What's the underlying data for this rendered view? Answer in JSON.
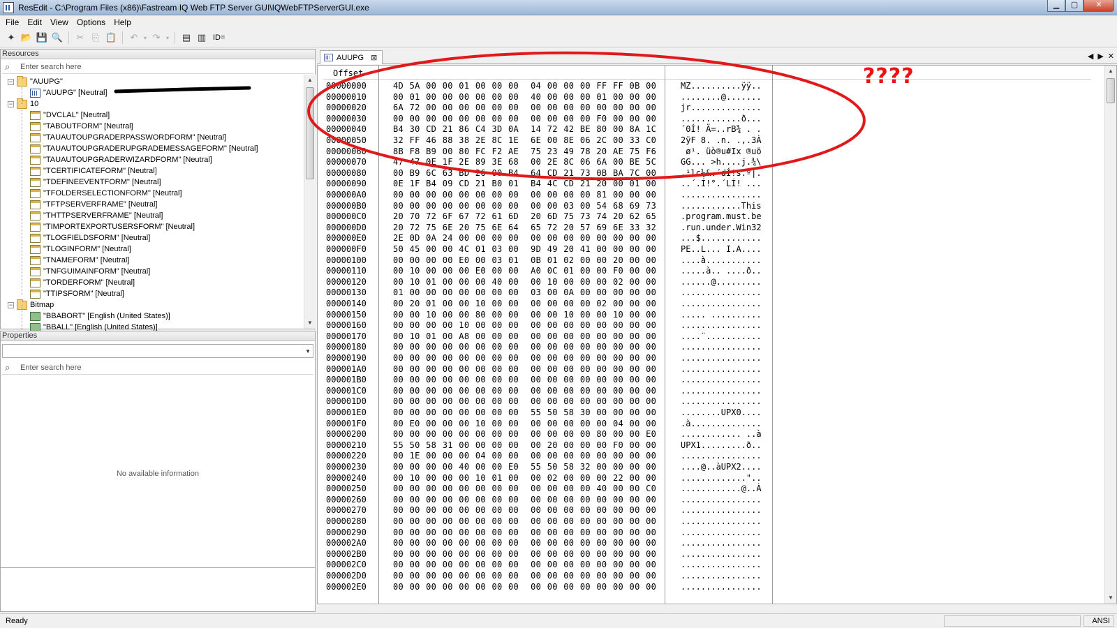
{
  "window": {
    "title": "ResEdit - C:\\Program Files (x86)\\Fastream IQ Web FTP Server GUI\\IQWebFTPServerGUI.exe",
    "buttons": [
      "minimize",
      "maximize",
      "close"
    ]
  },
  "menu": [
    "File",
    "Edit",
    "View",
    "Options",
    "Help"
  ],
  "toolbar": {
    "icons": [
      "new-icon",
      "open-icon",
      "save-icon",
      "print-preview-icon",
      "cut-icon",
      "copy-icon",
      "paste-icon",
      "undo-icon",
      "redo-icon",
      "properties-icon",
      "resource-icon"
    ],
    "id_label": "ID="
  },
  "resources": {
    "header": "Resources",
    "search_placeholder": "Enter search here",
    "tree": [
      {
        "label": "\"AUUPG\"",
        "level": 0,
        "kind": "folder",
        "expander": "−"
      },
      {
        "label": "\"AUUPG\" [Neutral]",
        "level": 1,
        "kind": "bin"
      },
      {
        "label": "10",
        "level": 0,
        "kind": "folder",
        "expander": "−"
      },
      {
        "label": "\"DVCLAL\" [Neutral]",
        "level": 1,
        "kind": "form"
      },
      {
        "label": "\"TABOUTFORM\" [Neutral]",
        "level": 1,
        "kind": "form"
      },
      {
        "label": "\"TAUAUTOUPGRADERPASSWORDFORM\" [Neutral]",
        "level": 1,
        "kind": "form"
      },
      {
        "label": "\"TAUAUTOUPGRADERUPGRADEMESSAGEFORM\" [Neutral]",
        "level": 1,
        "kind": "form"
      },
      {
        "label": "\"TAUAUTOUPGRADERWIZARDFORM\" [Neutral]",
        "level": 1,
        "kind": "form"
      },
      {
        "label": "\"TCERTIFICATEFORM\" [Neutral]",
        "level": 1,
        "kind": "form"
      },
      {
        "label": "\"TDEFINEEVENTFORM\" [Neutral]",
        "level": 1,
        "kind": "form"
      },
      {
        "label": "\"TFOLDERSELECTIONFORM\" [Neutral]",
        "level": 1,
        "kind": "form"
      },
      {
        "label": "\"TFTPSERVERFRAME\" [Neutral]",
        "level": 1,
        "kind": "form"
      },
      {
        "label": "\"THTTPSERVERFRAME\" [Neutral]",
        "level": 1,
        "kind": "form"
      },
      {
        "label": "\"TIMPORTEXPORTUSERSFORM\" [Neutral]",
        "level": 1,
        "kind": "form"
      },
      {
        "label": "\"TLOGFIELDSFORM\" [Neutral]",
        "level": 1,
        "kind": "form"
      },
      {
        "label": "\"TLOGINFORM\" [Neutral]",
        "level": 1,
        "kind": "form"
      },
      {
        "label": "\"TNAMEFORM\" [Neutral]",
        "level": 1,
        "kind": "form"
      },
      {
        "label": "\"TNFGUIMAINFORM\" [Neutral]",
        "level": 1,
        "kind": "form"
      },
      {
        "label": "\"TORDERFORM\" [Neutral]",
        "level": 1,
        "kind": "form"
      },
      {
        "label": "\"TTIPSFORM\" [Neutral]",
        "level": 1,
        "kind": "form"
      },
      {
        "label": "Bitmap",
        "level": 0,
        "kind": "folder",
        "expander": "−"
      },
      {
        "label": "\"BBABORT\" [English (United States)]",
        "level": 1,
        "kind": "bmp"
      },
      {
        "label": "\"BBALL\" [English (United States)]",
        "level": 1,
        "kind": "bmp"
      }
    ]
  },
  "properties": {
    "header": "Properties",
    "search_placeholder": "Enter search here",
    "empty_text": "No available information"
  },
  "editor": {
    "tab_label": "AUUPG",
    "offset_header": "Offset",
    "rows": [
      {
        "off": "00000000",
        "hex": "4D 5A 00 00 01 00 00 00  04 00 00 00 FF FF 0B 00",
        "asc": "MZ..........ÿÿ.."
      },
      {
        "off": "00000010",
        "hex": "00 01 00 00 00 00 00 00  40 00 00 00 01 00 00 00",
        "asc": "........@......."
      },
      {
        "off": "00000020",
        "hex": "6A 72 00 00 00 00 00 00  00 00 00 00 00 00 00 00",
        "asc": "jr.............."
      },
      {
        "off": "00000030",
        "hex": "00 00 00 00 00 00 00 00  00 00 00 00 F0 00 00 00",
        "asc": "............ð..."
      },
      {
        "off": "00000040",
        "hex": "B4 30 CD 21 86 C4 3D 0A  14 72 42 BE 80 00 8A 1C",
        "asc": "´0Í! Ä=..rB¾ . ."
      },
      {
        "off": "00000050",
        "hex": "32 FF 46 88 38 2E 8C 1E  6E 00 8E 06 2C 00 33 C0",
        "asc": "2ÿF 8. .n. .,.3À"
      },
      {
        "off": "00000060",
        "hex": "8B F8 B9 00 80 FC F2 AE  75 23 49 78 20 AE 75 F6",
        "asc": " ø¹. üò®u#Ix ®uö"
      },
      {
        "off": "00000070",
        "hex": "47 47 0E 1F 2E 89 3E 68  00 2E 8C 06 6A 00 BE 5C",
        "asc": "GG... >h....j.¾\\"
      },
      {
        "off": "00000080",
        "hex": "00 B9 6C 63 BD 26 00 B4  64 CD 21 73 0B BA 7C 00",
        "asc": ".¹lc½&.´dÍ!s.º|."
      },
      {
        "off": "00000090",
        "hex": "0E 1F B4 09 CD 21 B0 01  B4 4C CD 21 20 00 01 00",
        "asc": "..´.Í!°.´LÍ! ..."
      },
      {
        "off": "000000A0",
        "hex": "00 00 00 00 00 00 00 00  00 00 00 00 81 00 00 00",
        "asc": "................"
      },
      {
        "off": "000000B0",
        "hex": "00 00 00 00 00 00 00 00  00 00 03 00 54 68 69 73",
        "asc": "............This"
      },
      {
        "off": "000000C0",
        "hex": "20 70 72 6F 67 72 61 6D  20 6D 75 73 74 20 62 65",
        "asc": ".program.must.be"
      },
      {
        "off": "000000D0",
        "hex": "20 72 75 6E 20 75 6E 64  65 72 20 57 69 6E 33 32",
        "asc": ".run.under.Win32"
      },
      {
        "off": "000000E0",
        "hex": "2E 0D 0A 24 00 00 00 00  00 00 00 00 00 00 00 00",
        "asc": "...$............"
      },
      {
        "off": "000000F0",
        "hex": "50 45 00 00 4C 01 03 00  9D 49 20 41 00 00 00 00",
        "asc": "PE..L... I.A...."
      },
      {
        "off": "00000100",
        "hex": "00 00 00 00 E0 00 03 01  0B 01 02 00 00 20 00 00",
        "asc": "....à..........."
      },
      {
        "off": "00000110",
        "hex": "00 10 00 00 00 E0 00 00  A0 0C 01 00 00 F0 00 00",
        "asc": ".....à.. ....ð.."
      },
      {
        "off": "00000120",
        "hex": "00 10 01 00 00 00 40 00  00 10 00 00 00 02 00 00",
        "asc": "......@........."
      },
      {
        "off": "00000130",
        "hex": "01 00 00 00 00 00 00 00  03 00 0A 00 00 00 00 00",
        "asc": "................"
      },
      {
        "off": "00000140",
        "hex": "00 20 01 00 00 10 00 00  00 00 00 00 02 00 00 00",
        "asc": "................"
      },
      {
        "off": "00000150",
        "hex": "00 00 10 00 00 80 00 00  00 00 10 00 00 10 00 00",
        "asc": "..... .........."
      },
      {
        "off": "00000160",
        "hex": "00 00 00 00 10 00 00 00  00 00 00 00 00 00 00 00",
        "asc": "................"
      },
      {
        "off": "00000170",
        "hex": "00 10 01 00 A8 00 00 00  00 00 00 00 00 00 00 00",
        "asc": "....¨..........."
      },
      {
        "off": "00000180",
        "hex": "00 00 00 00 00 00 00 00  00 00 00 00 00 00 00 00",
        "asc": "................"
      },
      {
        "off": "00000190",
        "hex": "00 00 00 00 00 00 00 00  00 00 00 00 00 00 00 00",
        "asc": "................"
      },
      {
        "off": "000001A0",
        "hex": "00 00 00 00 00 00 00 00  00 00 00 00 00 00 00 00",
        "asc": "................"
      },
      {
        "off": "000001B0",
        "hex": "00 00 00 00 00 00 00 00  00 00 00 00 00 00 00 00",
        "asc": "................"
      },
      {
        "off": "000001C0",
        "hex": "00 00 00 00 00 00 00 00  00 00 00 00 00 00 00 00",
        "asc": "................"
      },
      {
        "off": "000001D0",
        "hex": "00 00 00 00 00 00 00 00  00 00 00 00 00 00 00 00",
        "asc": "................"
      },
      {
        "off": "000001E0",
        "hex": "00 00 00 00 00 00 00 00  55 50 58 30 00 00 00 00",
        "asc": "........UPX0...."
      },
      {
        "off": "000001F0",
        "hex": "00 E0 00 00 00 10 00 00  00 00 00 00 00 04 00 00",
        "asc": ".à.............."
      },
      {
        "off": "00000200",
        "hex": "00 00 00 00 00 00 00 00  00 00 00 00 80 00 00 E0",
        "asc": "............ ..à"
      },
      {
        "off": "00000210",
        "hex": "55 50 58 31 00 00 00 00  00 20 00 00 00 F0 00 00",
        "asc": "UPX1.........ð.."
      },
      {
        "off": "00000220",
        "hex": "00 1E 00 00 00 04 00 00  00 00 00 00 00 00 00 00",
        "asc": "................"
      },
      {
        "off": "00000230",
        "hex": "00 00 00 00 40 00 00 E0  55 50 58 32 00 00 00 00",
        "asc": "....@..àUPX2...."
      },
      {
        "off": "00000240",
        "hex": "00 10 00 00 00 10 01 00  00 02 00 00 00 22 00 00",
        "asc": ".............\".."
      },
      {
        "off": "00000250",
        "hex": "00 00 00 00 00 00 00 00  00 00 00 00 40 00 00 C0",
        "asc": "............@..À"
      },
      {
        "off": "00000260",
        "hex": "00 00 00 00 00 00 00 00  00 00 00 00 00 00 00 00",
        "asc": "................"
      },
      {
        "off": "00000270",
        "hex": "00 00 00 00 00 00 00 00  00 00 00 00 00 00 00 00",
        "asc": "................"
      },
      {
        "off": "00000280",
        "hex": "00 00 00 00 00 00 00 00  00 00 00 00 00 00 00 00",
        "asc": "................"
      },
      {
        "off": "00000290",
        "hex": "00 00 00 00 00 00 00 00  00 00 00 00 00 00 00 00",
        "asc": "................"
      },
      {
        "off": "000002A0",
        "hex": "00 00 00 00 00 00 00 00  00 00 00 00 00 00 00 00",
        "asc": "................"
      },
      {
        "off": "000002B0",
        "hex": "00 00 00 00 00 00 00 00  00 00 00 00 00 00 00 00",
        "asc": "................"
      },
      {
        "off": "000002C0",
        "hex": "00 00 00 00 00 00 00 00  00 00 00 00 00 00 00 00",
        "asc": "................"
      },
      {
        "off": "000002D0",
        "hex": "00 00 00 00 00 00 00 00  00 00 00 00 00 00 00 00",
        "asc": "................"
      },
      {
        "off": "000002E0",
        "hex": "00 00 00 00 00 00 00 00  00 00 00 00 00 00 00 00",
        "asc": "................"
      }
    ]
  },
  "annotation": {
    "text": "????",
    "color": "#e01a1a"
  },
  "status": {
    "text": "Ready",
    "encoding": "ANSI"
  }
}
